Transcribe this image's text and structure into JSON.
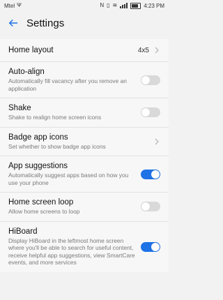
{
  "status": {
    "carrier": "Mtel",
    "time": "4:23 PM",
    "icons": [
      "usb-icon",
      "nfc-icon",
      "vibrate-icon",
      "wifi-icon",
      "signal-icon",
      "battery-icon"
    ]
  },
  "appbar": {
    "title": "Settings"
  },
  "items": [
    {
      "label": "Home layout",
      "value": "4x5",
      "type": "nav"
    },
    {
      "label": "Auto-align",
      "desc": "Automatically fill vacancy after you remove an application",
      "type": "toggle",
      "on": false
    },
    {
      "label": "Shake",
      "desc": "Shake to realign home screen icons",
      "type": "toggle",
      "on": false
    },
    {
      "label": "Badge app icons",
      "desc": "Set whether to show badge app icons",
      "type": "nav"
    },
    {
      "label": "App suggestions",
      "desc": "Automatically suggest apps based on how you use your phone",
      "type": "toggle",
      "on": true
    },
    {
      "label": "Home screen loop",
      "desc": "Allow home screens to loop",
      "type": "toggle",
      "on": false
    },
    {
      "label": "HiBoard",
      "desc": "Display HiBoard in the leftmost home screen where you'll be able to search for useful content, receive helpful app suggestions, view SmartCare events, and more services",
      "type": "toggle",
      "on": true
    }
  ],
  "colors": {
    "accent": "#1e72e6"
  }
}
